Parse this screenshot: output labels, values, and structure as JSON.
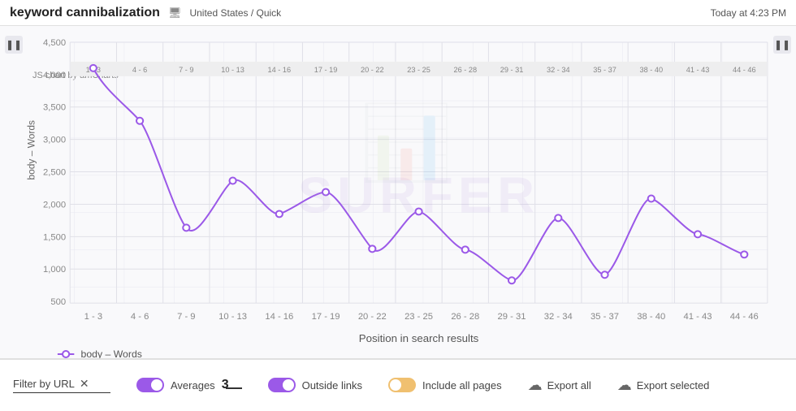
{
  "header": {
    "title": "keyword cannibalization",
    "location": "United States / Quick",
    "timestamp": "Today at 4:23 PM"
  },
  "chart": {
    "watermark": "SURFER",
    "amcharts_label": "JS chart by amCharts",
    "y_axis_label": "body – Words",
    "x_axis_label": "Position in search results",
    "y_ticks": [
      "4,500",
      "4,000",
      "3,500",
      "3,000",
      "2,500",
      "2,000",
      "1,500",
      "1,000",
      "500"
    ],
    "x_ticks": [
      "1 - 3",
      "4 - 6",
      "7 - 9",
      "10 - 13",
      "14 - 16",
      "17 - 19",
      "20 - 22",
      "23 - 25",
      "26 - 28",
      "29 - 31",
      "32 - 34",
      "35 - 37",
      "38 - 40",
      "41 - 43",
      "44 - 46"
    ],
    "legend": "body – Words",
    "data_points": [
      {
        "x": 0,
        "y": 4100
      },
      {
        "x": 1,
        "y": 3300
      },
      {
        "x": 2,
        "y": 1650
      },
      {
        "x": 3,
        "y": 2380
      },
      {
        "x": 4,
        "y": 1870
      },
      {
        "x": 5,
        "y": 2200
      },
      {
        "x": 6,
        "y": 1330
      },
      {
        "x": 7,
        "y": 1900
      },
      {
        "x": 8,
        "y": 1320
      },
      {
        "x": 9,
        "y": 850
      },
      {
        "x": 10,
        "y": 1810
      },
      {
        "x": 11,
        "y": 940
      },
      {
        "x": 12,
        "y": 2100
      },
      {
        "x": 13,
        "y": 1560
      },
      {
        "x": 14,
        "y": 1250
      }
    ]
  },
  "footer": {
    "filter_label": "Filter by URL",
    "filter_clear": "✕",
    "averages_label": "Averages",
    "averages_value": "3",
    "outside_links_label": "Outside links",
    "include_all_label": "Include all pages",
    "export_all_label": "Export all",
    "export_selected_label": "Export selected"
  },
  "scroll": {
    "left": "❚❚",
    "right": "❚❚"
  }
}
